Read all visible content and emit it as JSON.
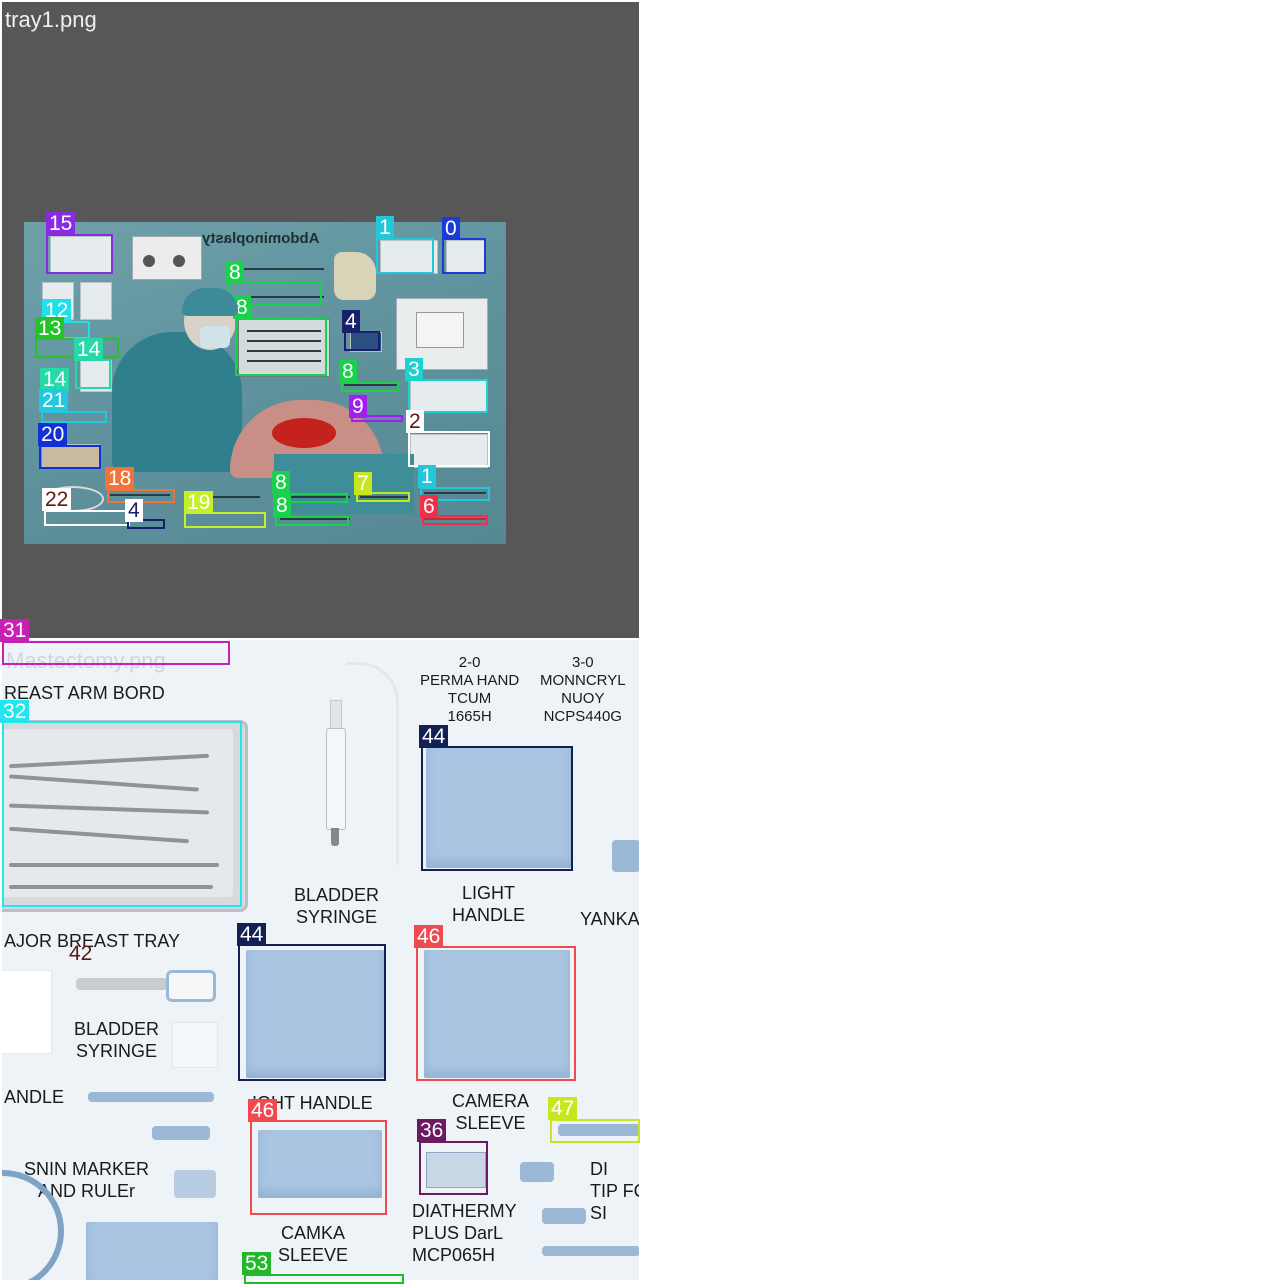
{
  "panels": {
    "top": {
      "filename": "tray1.png"
    },
    "bottom": {
      "filename": "Mastectomy.png"
    }
  },
  "poster": {
    "title": "Abdominoplasty"
  },
  "bottom_labels": {
    "arm_board": "REAST ARM BORD",
    "suture_2_0": "2-0\nPERMA HAND\nTCUM\n1665H",
    "suture_3_0": "3-0\nMONNCRYL\nNUOY\nNCPS440G",
    "bladder_syringe_1": "BLADDER\nSYRINGE",
    "light_handle_1": "LIGHT\nHANDLE",
    "yankauer": "YANKA",
    "major_tray": "AJOR BREAST TRAY",
    "bladder_syringe_2": "BLADDER\nSYRINGE",
    "light_handle_2": "IGHT HANDLE",
    "handle": "ANDLE",
    "camera_sleeve_1": "CAMERA\nSLEEVE",
    "skin_marker": "SNIN MARKER\nAND RULEr",
    "camera_sleeve_2": "CAMKA\nSLEEVE",
    "diathermy": "DIATHERMY\nPLUS DarL\nMCP065H",
    "dia_tip": "DI\nTIP FC\nSI"
  },
  "annotations": [
    {
      "id": "15",
      "color": "#8a2be2"
    },
    {
      "id": "1",
      "color": "#22c7d9"
    },
    {
      "id": "0",
      "color": "#1a3bd6"
    },
    {
      "id": "8",
      "color": "#19d14a"
    },
    {
      "id": "4",
      "color": "#18206b"
    },
    {
      "id": "12",
      "color": "#22e0e8"
    },
    {
      "id": "13",
      "color": "#26c22a"
    },
    {
      "id": "14",
      "color": "#28d9a8"
    },
    {
      "id": "3",
      "color": "#1ad3cf"
    },
    {
      "id": "9",
      "color": "#a020f0"
    },
    {
      "id": "21",
      "color": "#22c7e0"
    },
    {
      "id": "2",
      "color": "#ffffff"
    },
    {
      "id": "20",
      "color": "#1230d8"
    },
    {
      "id": "18",
      "color": "#f0743a"
    },
    {
      "id": "7",
      "color": "#c8e61e"
    },
    {
      "id": "6",
      "color": "#f0304a"
    },
    {
      "id": "22",
      "color": "#ffffff"
    },
    {
      "id": "19",
      "color": "#c4ef2a"
    },
    {
      "id": "31",
      "color": "#c820b4"
    },
    {
      "id": "32",
      "color": "#22e6ee"
    },
    {
      "id": "44",
      "color": "#142054"
    },
    {
      "id": "42",
      "color": "#5a1a12"
    },
    {
      "id": "46",
      "color": "#f04a50"
    },
    {
      "id": "47",
      "color": "#c8e61e"
    },
    {
      "id": "36",
      "color": "#6a1a62"
    },
    {
      "id": "53",
      "color": "#22b82a"
    }
  ]
}
